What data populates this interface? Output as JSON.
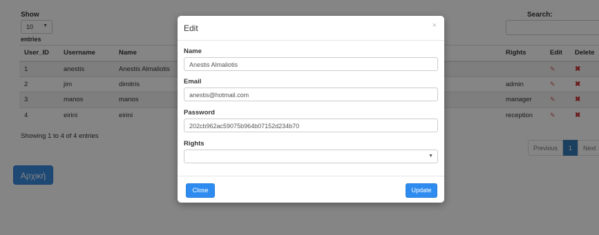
{
  "length_menu": {
    "show_label": "Show",
    "selected": "10",
    "entries_label": "entries"
  },
  "search": {
    "label": "Search:",
    "value": ""
  },
  "table": {
    "headers": {
      "user_id": "User_ID",
      "username": "Username",
      "name": "Name",
      "rights": "Rights",
      "edit": "Edit",
      "delete": "Delete"
    },
    "rows": [
      {
        "user_id": "1",
        "username": "anestis",
        "name": "Anestis Almaliotis",
        "rights": ""
      },
      {
        "user_id": "2",
        "username": "jim",
        "name": "dimitris",
        "rights": "admin"
      },
      {
        "user_id": "3",
        "username": "manos",
        "name": "manos",
        "rights": "manager"
      },
      {
        "user_id": "4",
        "username": "eirini",
        "name": "eirini",
        "rights": "reception"
      }
    ]
  },
  "info_text": "Showing 1 to 4 of 4 entries",
  "pagination": {
    "previous": "Previous",
    "current_page": "1",
    "next": "Next"
  },
  "home_button": "Αρχική",
  "modal": {
    "title": "Edit",
    "close_x": "×",
    "name_label": "Name",
    "name_value": "Anestis Almaliotis",
    "email_label": "Email",
    "email_value": "anestis@hotmail.com",
    "password_label": "Password",
    "password_value": "202cb962ac59075b964b07152d234b70",
    "rights_label": "Rights",
    "rights_value": "",
    "close_button": "Close",
    "update_button": "Update"
  },
  "icons": {
    "edit": "pencil-square-icon",
    "delete": "x-mark-icon"
  },
  "colors": {
    "primary": "#2e8cf0",
    "delete_icon": "#c9302c",
    "edit_icon": "#d9534f"
  }
}
